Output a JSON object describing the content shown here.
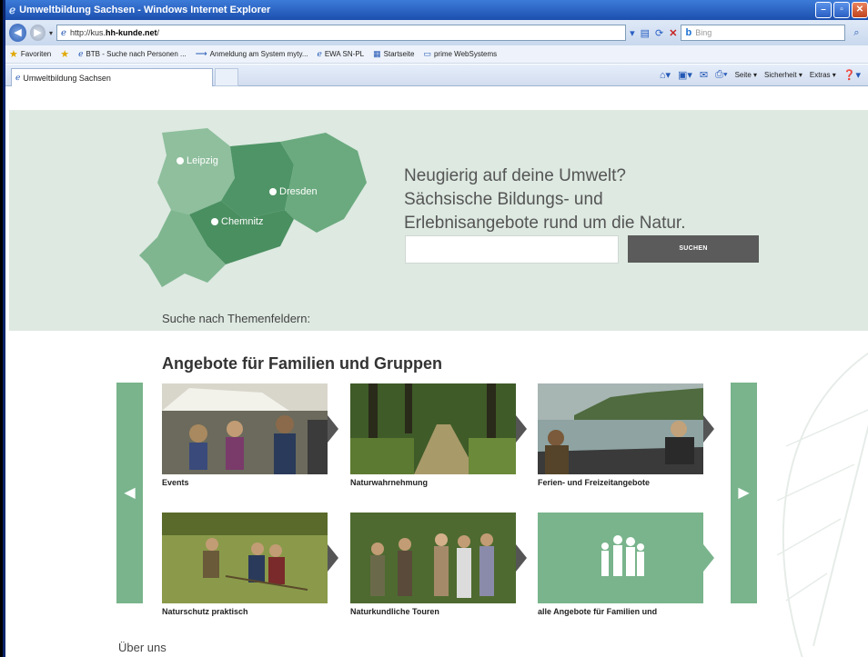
{
  "window": {
    "title": "Umweltbildung Sachsen - Windows Internet Explorer"
  },
  "address_bar": {
    "url_prefix": "http://kus.",
    "url_domain": "hh-kunde.net",
    "url_suffix": "/",
    "search_placeholder": "Bing"
  },
  "favorites_bar": {
    "favorites_label": "Favoriten",
    "items": [
      "BTB - Suche nach Personen ...",
      "Anmeldung am System myty...",
      "EWA SN-PL",
      "Startseite",
      "prime WebSystems"
    ]
  },
  "tabs": {
    "active_tab": "Umweltbildung Sachsen"
  },
  "command_bar": {
    "seite": "Seite ▾",
    "sicherheit": "Sicherheit ▾",
    "extras": "Extras ▾"
  },
  "hero": {
    "headline_lines": [
      "Neugierig auf deine Umwelt?",
      "Sächsische Bildungs- und",
      "Erlebnisangebote rund um die Natur."
    ],
    "search_button": "SUCHEN",
    "themen_label": "Suche nach Themenfeldern:",
    "cities": [
      "Leipzig",
      "Dresden",
      "Chemnitz"
    ]
  },
  "section": {
    "title": "Angebote für Familien und Gruppen",
    "tiles": [
      "Events",
      "Naturwahrnehmung",
      "Ferien- und Freizeitangebote",
      "Naturschutz praktisch",
      "Naturkundliche Touren",
      "alle Angebote für Familien und"
    ]
  },
  "footer": {
    "ueber_uns": "Über uns"
  },
  "colors": {
    "hero_bg": "#dde9e1",
    "accent_green": "#79b48c",
    "search_button": "#5a5b5a"
  }
}
